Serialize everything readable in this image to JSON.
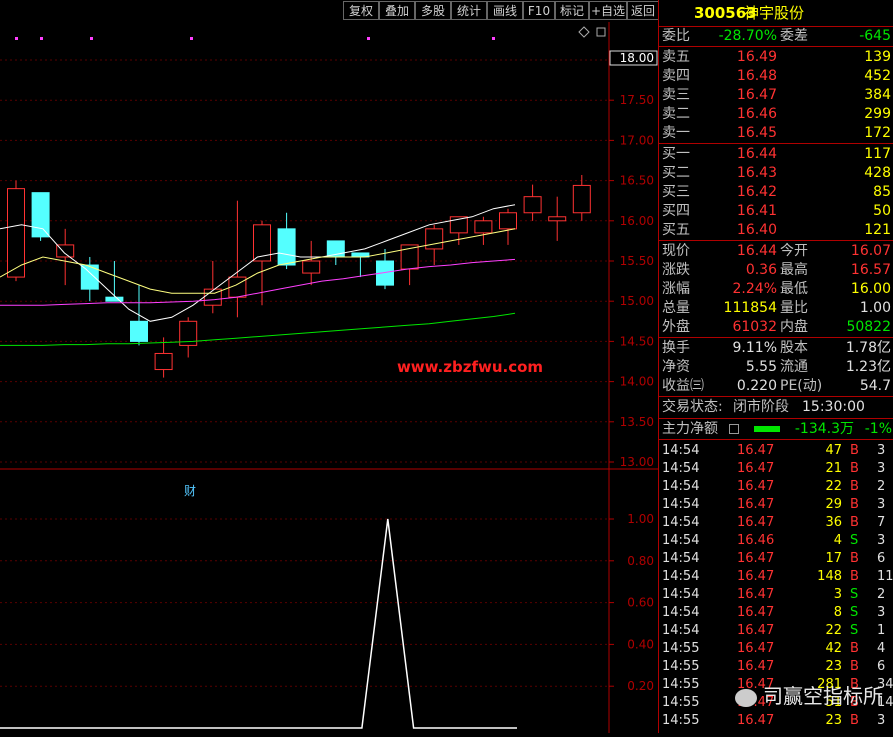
{
  "toolbar": {
    "buttons": [
      "复权",
      "叠加",
      "多股",
      "统计",
      "画线",
      "F10",
      "标记",
      "+自选",
      "返回"
    ]
  },
  "chart_data": [
    {
      "type": "candlestick",
      "y_ticks": [
        "18.00",
        "17.50",
        "17.00",
        "16.50",
        "16.00",
        "15.50",
        "15.00",
        "14.50",
        "14.00",
        "13.50",
        "13.00"
      ],
      "current_price_label": "18.00",
      "watermark": "www.zbzfwu.com",
      "badge": "财",
      "colors": {
        "up": "#ff3232",
        "down": "#54ffff",
        "ma5": "#ffffff",
        "ma10": "#ffff80",
        "ma20": "#ff40ff",
        "ma60": "#00e600"
      },
      "candles": [
        {
          "o": 15.3,
          "h": 16.5,
          "l": 15.25,
          "c": 16.4
        },
        {
          "o": 16.35,
          "h": 16.35,
          "l": 15.75,
          "c": 15.8
        },
        {
          "o": 15.55,
          "h": 15.9,
          "l": 15.2,
          "c": 15.7
        },
        {
          "o": 15.45,
          "h": 15.55,
          "l": 15.0,
          "c": 15.15
        },
        {
          "o": 15.05,
          "h": 15.5,
          "l": 15.0,
          "c": 15.0
        },
        {
          "o": 14.75,
          "h": 15.2,
          "l": 14.45,
          "c": 14.5
        },
        {
          "o": 14.15,
          "h": 14.55,
          "l": 14.05,
          "c": 14.35
        },
        {
          "o": 14.45,
          "h": 14.8,
          "l": 14.3,
          "c": 14.75
        },
        {
          "o": 14.95,
          "h": 15.5,
          "l": 14.85,
          "c": 15.15
        },
        {
          "o": 15.05,
          "h": 16.25,
          "l": 14.8,
          "c": 15.3
        },
        {
          "o": 15.5,
          "h": 16.0,
          "l": 14.95,
          "c": 15.95
        },
        {
          "o": 15.9,
          "h": 16.1,
          "l": 15.4,
          "c": 15.45
        },
        {
          "o": 15.35,
          "h": 15.75,
          "l": 15.2,
          "c": 15.5
        },
        {
          "o": 15.75,
          "h": 15.75,
          "l": 15.45,
          "c": 15.55
        },
        {
          "o": 15.6,
          "h": 15.6,
          "l": 15.3,
          "c": 15.55
        },
        {
          "o": 15.5,
          "h": 15.65,
          "l": 15.15,
          "c": 15.2
        },
        {
          "o": 15.4,
          "h": 15.7,
          "l": 15.2,
          "c": 15.7
        },
        {
          "o": 15.65,
          "h": 15.95,
          "l": 15.45,
          "c": 15.9
        },
        {
          "o": 15.85,
          "h": 16.05,
          "l": 15.7,
          "c": 16.05
        },
        {
          "o": 15.85,
          "h": 16.05,
          "l": 15.7,
          "c": 16.0
        },
        {
          "o": 15.9,
          "h": 16.15,
          "l": 15.7,
          "c": 16.1
        },
        {
          "o": 16.1,
          "h": 16.45,
          "l": 16.0,
          "c": 16.3
        },
        {
          "o": 16.0,
          "h": 16.3,
          "l": 15.75,
          "c": 16.05
        },
        {
          "o": 16.1,
          "h": 16.57,
          "l": 16.0,
          "c": 16.44
        }
      ],
      "ma5": [
        15.9,
        15.95,
        15.9,
        15.6,
        15.4,
        15.15,
        14.9,
        14.75,
        14.8,
        14.95,
        15.15,
        15.35,
        15.55,
        15.6,
        15.55,
        15.55,
        15.6,
        15.65,
        15.75,
        15.85,
        15.95,
        16.0,
        16.05,
        16.15,
        16.2
      ],
      "ma10": [
        15.3,
        15.45,
        15.55,
        15.5,
        15.45,
        15.35,
        15.25,
        15.15,
        15.1,
        15.1,
        15.1,
        15.2,
        15.35,
        15.45,
        15.5,
        15.55,
        15.55,
        15.55,
        15.6,
        15.65,
        15.7,
        15.75,
        15.8,
        15.85,
        15.9
      ],
      "ma20": [
        14.95,
        14.95,
        14.95,
        14.96,
        14.97,
        14.98,
        14.98,
        14.98,
        14.99,
        15.0,
        15.02,
        15.05,
        15.1,
        15.15,
        15.2,
        15.25,
        15.28,
        15.32,
        15.36,
        15.4,
        15.43,
        15.45,
        15.48,
        15.5,
        15.52
      ],
      "ma60": [
        14.45,
        14.45,
        14.45,
        14.46,
        14.46,
        14.47,
        14.47,
        14.48,
        14.49,
        14.5,
        14.52,
        14.54,
        14.56,
        14.58,
        14.6,
        14.62,
        14.64,
        14.66,
        14.68,
        14.7,
        14.72,
        14.75,
        14.78,
        14.81,
        14.85
      ]
    },
    {
      "type": "line",
      "y_ticks": [
        "1.00",
        "0.80",
        "0.60",
        "0.40",
        "0.20"
      ],
      "color": "#ffffff",
      "values": [
        0,
        0,
        0,
        0,
        0,
        0,
        0,
        0,
        0,
        0,
        0,
        0,
        0,
        0,
        0,
        1.0,
        0,
        0,
        0,
        0,
        0
      ]
    }
  ],
  "panel": {
    "code": "300563",
    "name": "神宇股份",
    "weibi_label": "委比",
    "weibi": "-28.70%",
    "weicha_label": "委差",
    "weicha": "-645",
    "sells": [
      {
        "label": "卖五",
        "price": "16.49",
        "vol": "139"
      },
      {
        "label": "卖四",
        "price": "16.48",
        "vol": "452"
      },
      {
        "label": "卖三",
        "price": "16.47",
        "vol": "384"
      },
      {
        "label": "卖二",
        "price": "16.46",
        "vol": "299"
      },
      {
        "label": "卖一",
        "price": "16.45",
        "vol": "172"
      }
    ],
    "buys": [
      {
        "label": "买一",
        "price": "16.44",
        "vol": "117"
      },
      {
        "label": "买二",
        "price": "16.43",
        "vol": "428"
      },
      {
        "label": "买三",
        "price": "16.42",
        "vol": "85"
      },
      {
        "label": "买四",
        "price": "16.41",
        "vol": "50"
      },
      {
        "label": "买五",
        "price": "16.40",
        "vol": "121"
      }
    ],
    "stats": [
      {
        "l1": "现价",
        "v1": "16.44",
        "c1": "red",
        "l2": "今开",
        "v2": "16.07",
        "c2": "red"
      },
      {
        "l1": "涨跌",
        "v1": "0.36",
        "c1": "red",
        "l2": "最高",
        "v2": "16.57",
        "c2": "red"
      },
      {
        "l1": "涨幅",
        "v1": "2.24%",
        "c1": "red",
        "l2": "最低",
        "v2": "16.00",
        "c2": "yellow"
      },
      {
        "l1": "总量",
        "v1": "111854",
        "c1": "yellow",
        "l2": "量比",
        "v2": "1.00",
        "c2": "white"
      },
      {
        "l1": "外盘",
        "v1": "61032",
        "c1": "red",
        "l2": "内盘",
        "v2": "50822",
        "c2": "green"
      }
    ],
    "stats2": [
      {
        "l1": "换手",
        "v1": "9.11%",
        "l2": "股本",
        "v2": "1.78亿"
      },
      {
        "l1": "净资",
        "v1": "5.55",
        "l2": "流通",
        "v2": "1.23亿"
      },
      {
        "l1": "收益㈢",
        "v1": "0.220",
        "l2": "PE(动)",
        "v2": "54.7"
      }
    ],
    "trade_status_label": "交易状态:",
    "trade_status": "闭市阶段",
    "trade_time": "15:30:00",
    "main_net_label": "主力净额",
    "main_net": "-134.3万",
    "main_net_pct": "-1%",
    "ticks": [
      {
        "t": "14:54",
        "p": "16.47",
        "v": "47",
        "s": "B",
        "n": "3"
      },
      {
        "t": "14:54",
        "p": "16.47",
        "v": "21",
        "s": "B",
        "n": "3"
      },
      {
        "t": "14:54",
        "p": "16.47",
        "v": "22",
        "s": "B",
        "n": "2"
      },
      {
        "t": "14:54",
        "p": "16.47",
        "v": "29",
        "s": "B",
        "n": "3"
      },
      {
        "t": "14:54",
        "p": "16.47",
        "v": "36",
        "s": "B",
        "n": "7"
      },
      {
        "t": "14:54",
        "p": "16.46",
        "v": "4",
        "s": "S",
        "n": "3"
      },
      {
        "t": "14:54",
        "p": "16.47",
        "v": "17",
        "s": "B",
        "n": "6"
      },
      {
        "t": "14:54",
        "p": "16.47",
        "v": "148",
        "s": "B",
        "n": "11"
      },
      {
        "t": "14:54",
        "p": "16.47",
        "v": "3",
        "s": "S",
        "n": "2"
      },
      {
        "t": "14:54",
        "p": "16.47",
        "v": "8",
        "s": "S",
        "n": "3"
      },
      {
        "t": "14:54",
        "p": "16.47",
        "v": "22",
        "s": "S",
        "n": "1"
      },
      {
        "t": "14:55",
        "p": "16.47",
        "v": "42",
        "s": "B",
        "n": "4"
      },
      {
        "t": "14:55",
        "p": "16.47",
        "v": "23",
        "s": "B",
        "n": "6"
      },
      {
        "t": "14:55",
        "p": "16.47",
        "v": "281",
        "s": "B",
        "n": "34"
      },
      {
        "t": "14:55",
        "p": "16.47",
        "v": "51",
        "s": "B",
        "n": "14"
      },
      {
        "t": "14:55",
        "p": "16.47",
        "v": "23",
        "s": "B",
        "n": "3"
      }
    ],
    "watermark": "司赢空指标所"
  }
}
